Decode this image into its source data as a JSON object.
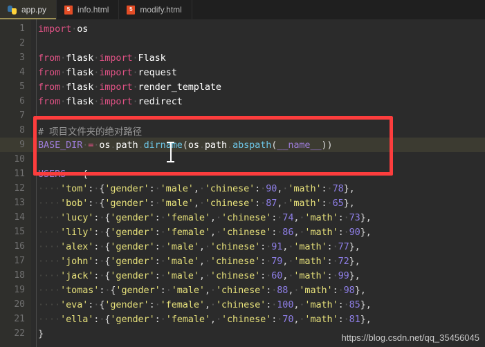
{
  "tabs": [
    {
      "label": "app.py",
      "icon": "python-icon",
      "active": true
    },
    {
      "label": "info.html",
      "icon": "html5-icon",
      "active": false
    },
    {
      "label": "modify.html",
      "icon": "html5-icon",
      "active": false
    }
  ],
  "html_icon_glyph": "5",
  "editor": {
    "language": "python",
    "filename": "app.py",
    "current_line": 9,
    "lines": [
      {
        "n": "1",
        "text": "import os"
      },
      {
        "n": "2",
        "text": ""
      },
      {
        "n": "3",
        "text": "from flask import Flask"
      },
      {
        "n": "4",
        "text": "from flask import request"
      },
      {
        "n": "5",
        "text": "from flask import render_template"
      },
      {
        "n": "6",
        "text": "from flask import redirect"
      },
      {
        "n": "7",
        "text": ""
      },
      {
        "n": "8",
        "text": "# 项目文件夹的绝对路径"
      },
      {
        "n": "9",
        "text": "BASE_DIR = os.path.dirname(os.path.abspath(__name__))"
      },
      {
        "n": "10",
        "text": ""
      },
      {
        "n": "11",
        "text": "USERS = {"
      },
      {
        "n": "12",
        "text": "    'tom': {'gender': 'male', 'chinese': 90, 'math': 78},"
      },
      {
        "n": "13",
        "text": "    'bob': {'gender': 'male', 'chinese': 87, 'math': 65},"
      },
      {
        "n": "14",
        "text": "    'lucy': {'gender': 'female', 'chinese': 74, 'math': 73},"
      },
      {
        "n": "15",
        "text": "    'lily': {'gender': 'female', 'chinese': 86, 'math': 90},"
      },
      {
        "n": "16",
        "text": "    'alex': {'gender': 'male', 'chinese': 91, 'math': 77},"
      },
      {
        "n": "17",
        "text": "    'john': {'gender': 'male', 'chinese': 79, 'math': 72},"
      },
      {
        "n": "18",
        "text": "    'jack': {'gender': 'male', 'chinese': 60, 'math': 99},"
      },
      {
        "n": "19",
        "text": "    'tomas': {'gender': 'male', 'chinese': 88, 'math': 98},"
      },
      {
        "n": "20",
        "text": "    'eva': {'gender': 'female', 'chinese': 100, 'math': 85},"
      },
      {
        "n": "21",
        "text": "    'ella': {'gender': 'female', 'chinese': 70, 'math': 81},"
      },
      {
        "n": "22",
        "text": "}"
      }
    ],
    "comment_line_8": "# 项目文件夹的绝对路径",
    "users_records": [
      {
        "name": "tom",
        "gender": "male",
        "chinese": 90,
        "math": 78
      },
      {
        "name": "bob",
        "gender": "male",
        "chinese": 87,
        "math": 65
      },
      {
        "name": "lucy",
        "gender": "female",
        "chinese": 74,
        "math": 73
      },
      {
        "name": "lily",
        "gender": "female",
        "chinese": 86,
        "math": 90
      },
      {
        "name": "alex",
        "gender": "male",
        "chinese": 91,
        "math": 77
      },
      {
        "name": "john",
        "gender": "male",
        "chinese": 79,
        "math": 72
      },
      {
        "name": "jack",
        "gender": "male",
        "chinese": 60,
        "math": 99
      },
      {
        "name": "tomas",
        "gender": "male",
        "chinese": 88,
        "math": 98
      },
      {
        "name": "eva",
        "gender": "female",
        "chinese": 100,
        "math": 85
      },
      {
        "name": "ella",
        "gender": "female",
        "chinese": 70,
        "math": 81
      }
    ]
  },
  "annotation": {
    "type": "red-rectangle-highlight",
    "color": "#fc3d3d",
    "covers_lines": "8-11"
  },
  "cursor": {
    "type": "i-beam-text-cursor",
    "over_token": "dirname"
  },
  "watermark": {
    "text": "https://blog.csdn.net/qq_35456045"
  },
  "colors": {
    "editor_bg": "#2b2b2b",
    "gutter_bg": "#2f2f2c",
    "tabbar_bg": "#1f1f1f",
    "active_tab_bg": "#32312b",
    "active_tab_underline": "#9d9055",
    "current_line_bg": "#3c3b31",
    "keyword": "#e05285",
    "string": "#e6e07a",
    "number": "#8f7fe8",
    "function": "#6dc7e8",
    "constant": "#9d7cd8",
    "comment": "#969696",
    "annotation_red": "#fc3d3d"
  }
}
